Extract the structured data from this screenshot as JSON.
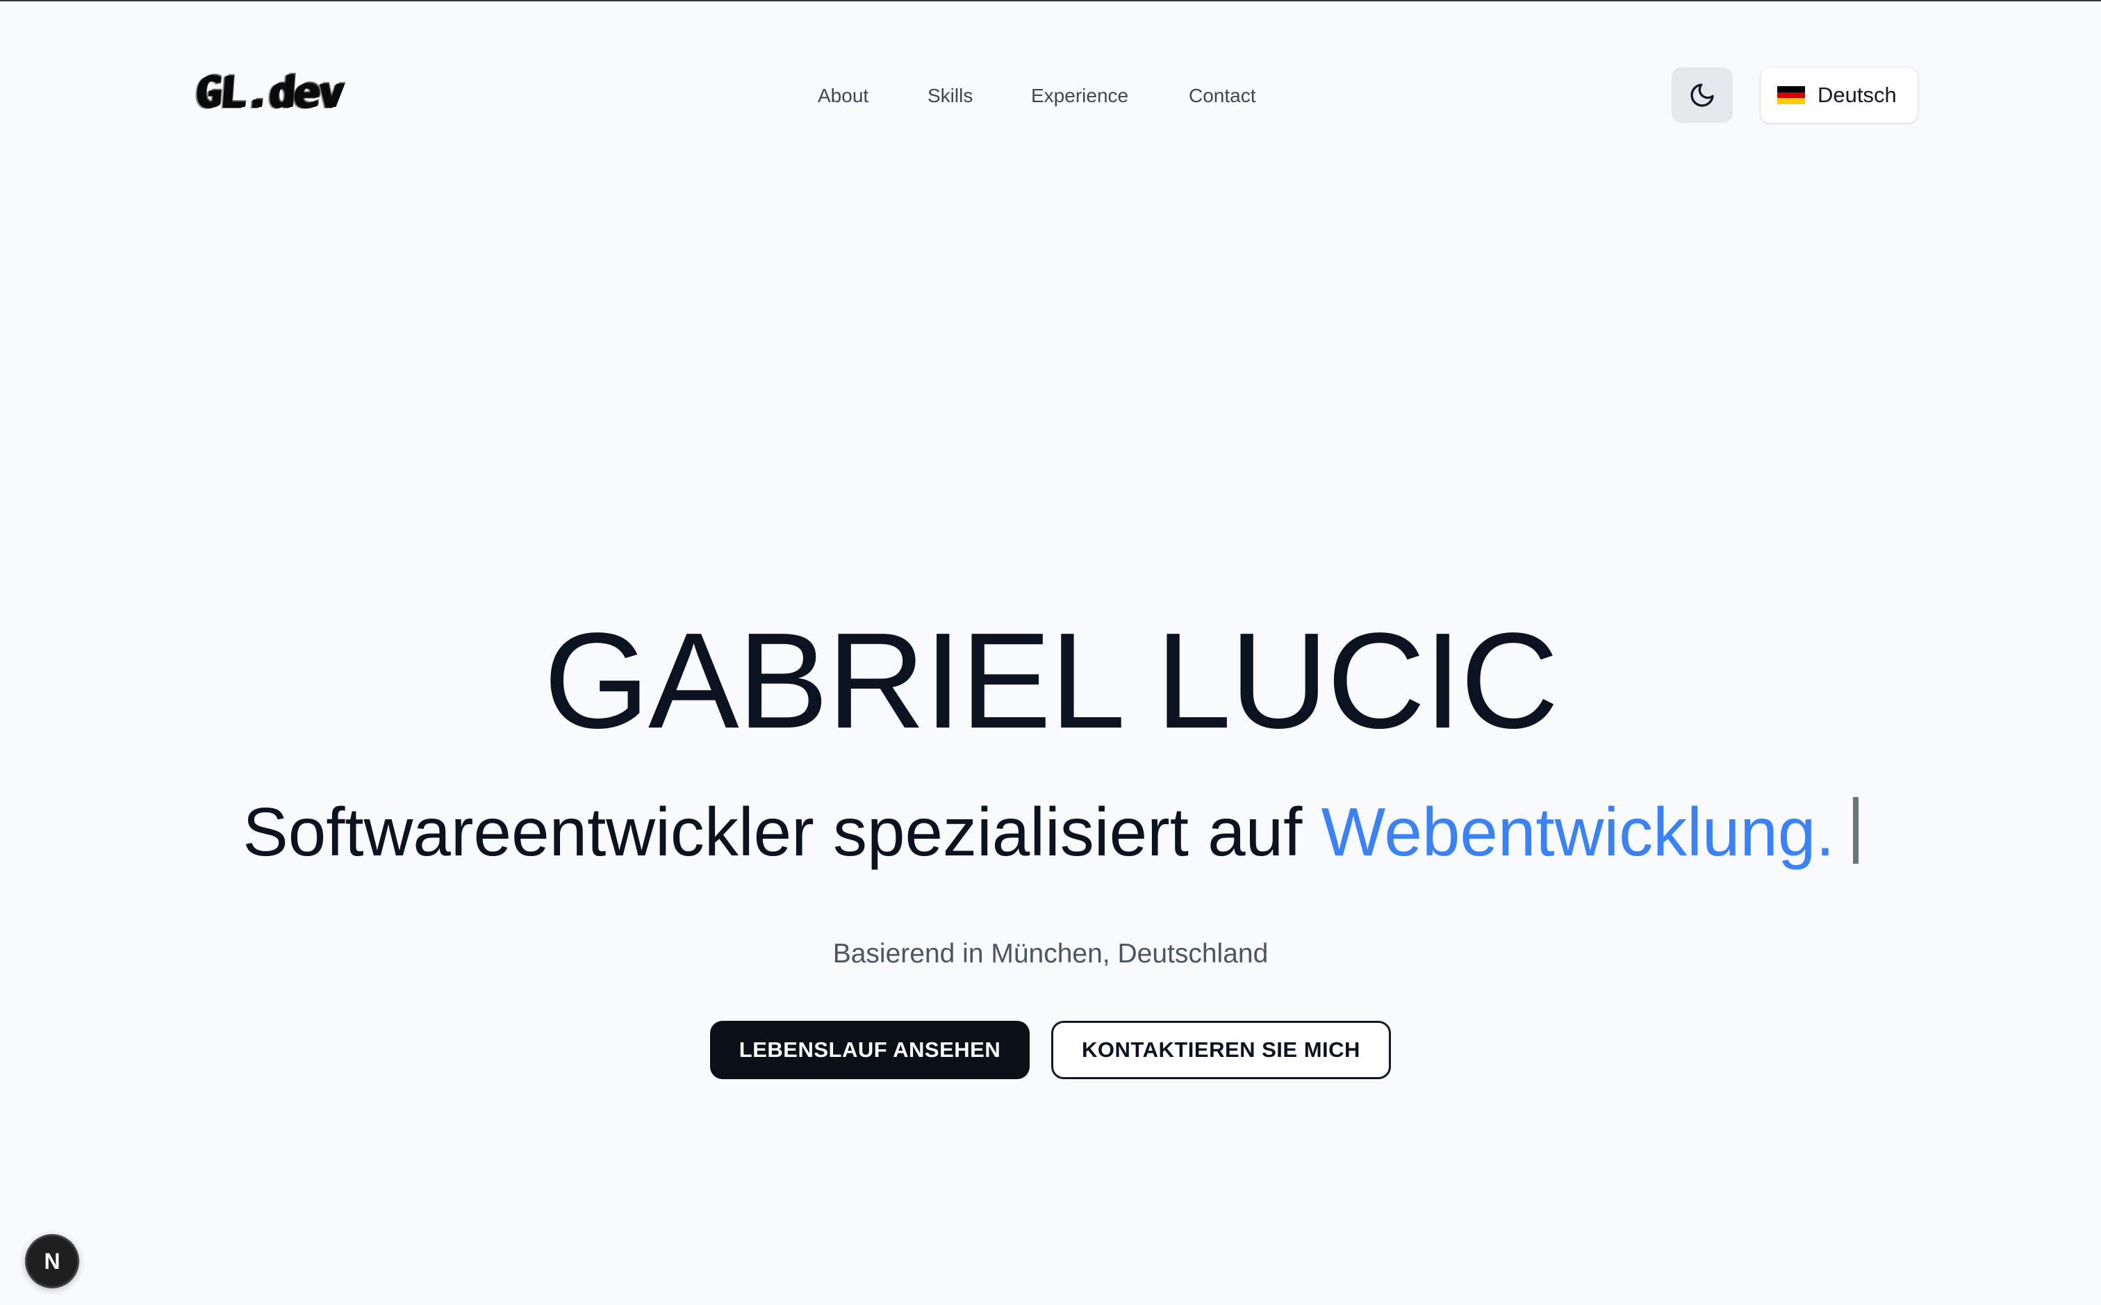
{
  "header": {
    "logo": "GL.dev",
    "nav": [
      {
        "label": "About"
      },
      {
        "label": "Skills"
      },
      {
        "label": "Experience"
      },
      {
        "label": "Contact"
      }
    ],
    "theme_toggle_icon": "moon-icon",
    "language": {
      "label": "Deutsch",
      "flag_icon": "germany-flag-icon",
      "flag_colors": [
        "#000000",
        "#dd0000",
        "#ffce00"
      ]
    }
  },
  "hero": {
    "name": "GABRIEL LUCIC",
    "tagline_prefix": "Softwareentwickler spezialisiert auf",
    "tagline_highlight": "Webentwicklung.",
    "location": "Basierend in München, Deutschland",
    "primary_button": "LEBENSLAUF ANSEHEN",
    "secondary_button": "KONTAKTIEREN SIE MICH"
  },
  "dev_badge": {
    "label": "N",
    "icon": "nextjs-icon"
  },
  "colors": {
    "background": "#f8fafc",
    "accent": "#3b82f6",
    "primary_button": "#0b0f17"
  }
}
